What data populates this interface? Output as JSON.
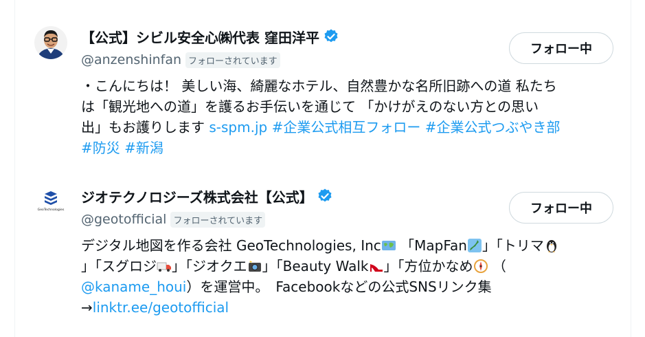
{
  "users": [
    {
      "display_name": "【公式】シビル安全心㈱代表 窪田洋平",
      "handle": "@anzenshinfan",
      "follows_you": "フォローされています",
      "button_label": "フォロー中",
      "bio": {
        "l1": "・こんにちは！ 美しい海、綺麗なホテル、自然豊かな名所旧跡への道 私たち",
        "l2": "は「観光地への道」を護るお手伝いを通じて 「かけがえのない方との思い",
        "l3a": "出」もお護りします ",
        "l3_link": "s-spm.jp",
        "l3_tag1": "#企業公式相互フォロー",
        "l3_tag2": "#企業公式つぶやき部",
        "l4_tag1": "#防災",
        "l4_tag2": "#新潟"
      }
    },
    {
      "display_name": "ジオテクノロジーズ株式会社【公式】",
      "handle": "@geotofficial",
      "follows_you": "フォローされています",
      "button_label": "フォロー中",
      "avatar_text": "GeoTechnologies",
      "bio": {
        "l1a": "デジタル地図を作る会社 GeoTechnologies, Inc",
        "l1b": " 「MapFan",
        "l1c": "」「トリマ",
        "l2a": "」「スグロジ",
        "l2b": "」「ジオクエ",
        "l2c": "」「Beauty Walk",
        "l2d": "」「方位かなめ",
        "l2e": " （",
        "l3_link": "@kaname_houi",
        "l3b": "）を運営中。　Facebookなどの公式SNSリンク集",
        "l4a": "→",
        "l4_link": "linktr.ee/geotofficial"
      }
    }
  ],
  "colors": {
    "link": "#1d9bf0",
    "verified": "#1d9bf0",
    "muted": "#536471"
  }
}
